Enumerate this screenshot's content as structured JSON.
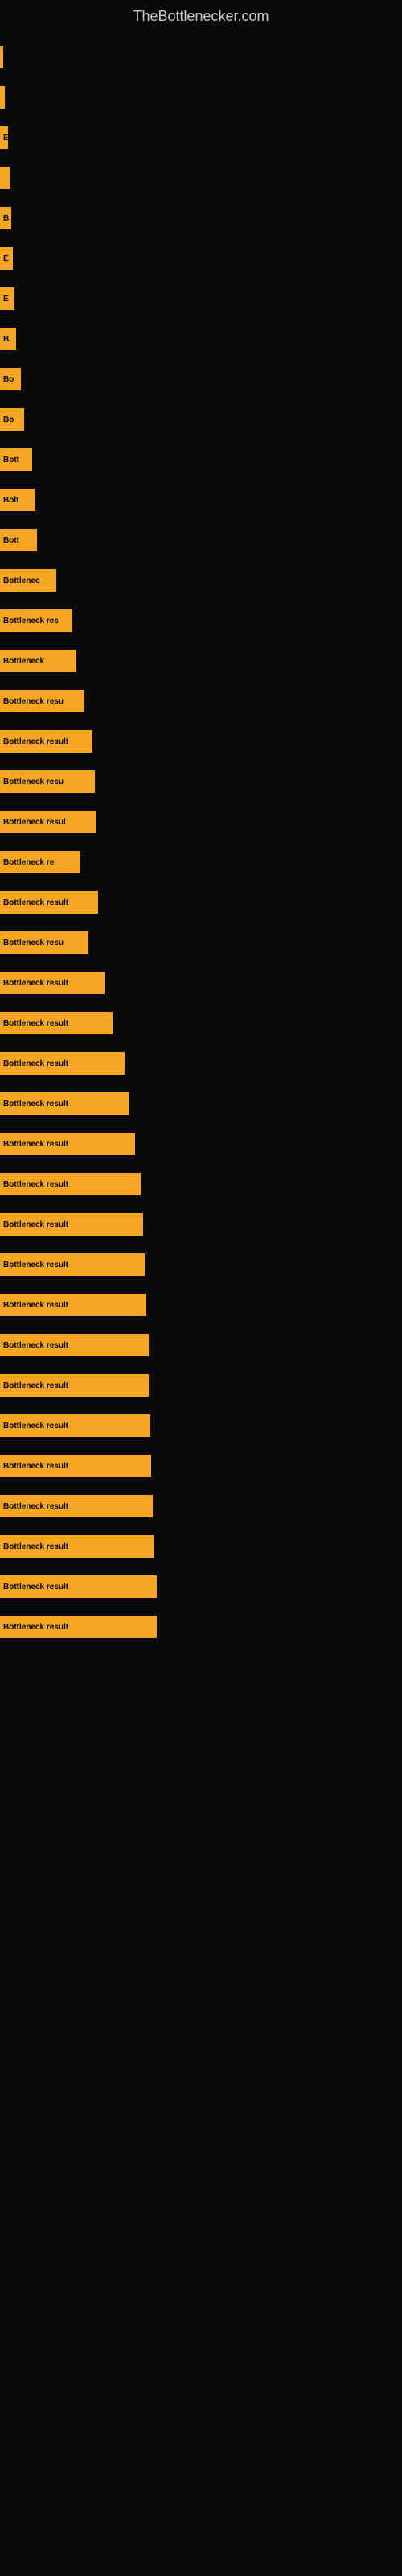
{
  "site": {
    "title": "TheBottlenecker.com"
  },
  "bars": [
    {
      "id": 1,
      "width": 4,
      "label": ""
    },
    {
      "id": 2,
      "width": 6,
      "label": ""
    },
    {
      "id": 3,
      "width": 10,
      "label": "E"
    },
    {
      "id": 4,
      "width": 12,
      "label": ""
    },
    {
      "id": 5,
      "width": 14,
      "label": "B"
    },
    {
      "id": 6,
      "width": 16,
      "label": "E"
    },
    {
      "id": 7,
      "width": 18,
      "label": "E"
    },
    {
      "id": 8,
      "width": 20,
      "label": "B"
    },
    {
      "id": 9,
      "width": 26,
      "label": "Bo"
    },
    {
      "id": 10,
      "width": 30,
      "label": "Bo"
    },
    {
      "id": 11,
      "width": 40,
      "label": "Bott"
    },
    {
      "id": 12,
      "width": 44,
      "label": "Bolt"
    },
    {
      "id": 13,
      "width": 46,
      "label": "Bott"
    },
    {
      "id": 14,
      "width": 70,
      "label": "Bottlenec"
    },
    {
      "id": 15,
      "width": 90,
      "label": "Bottleneck res"
    },
    {
      "id": 16,
      "width": 95,
      "label": "Bottleneck"
    },
    {
      "id": 17,
      "width": 105,
      "label": "Bottleneck resu"
    },
    {
      "id": 18,
      "width": 115,
      "label": "Bottleneck result"
    },
    {
      "id": 19,
      "width": 118,
      "label": "Bottleneck resu"
    },
    {
      "id": 20,
      "width": 120,
      "label": "Bottleneck resul"
    },
    {
      "id": 21,
      "width": 100,
      "label": "Bottleneck re"
    },
    {
      "id": 22,
      "width": 122,
      "label": "Bottleneck result"
    },
    {
      "id": 23,
      "width": 110,
      "label": "Bottleneck resu"
    },
    {
      "id": 24,
      "width": 130,
      "label": "Bottleneck result"
    },
    {
      "id": 25,
      "width": 140,
      "label": "Bottleneck result"
    },
    {
      "id": 26,
      "width": 155,
      "label": "Bottleneck result"
    },
    {
      "id": 27,
      "width": 160,
      "label": "Bottleneck result"
    },
    {
      "id": 28,
      "width": 168,
      "label": "Bottleneck result"
    },
    {
      "id": 29,
      "width": 175,
      "label": "Bottleneck result"
    },
    {
      "id": 30,
      "width": 178,
      "label": "Bottleneck result"
    },
    {
      "id": 31,
      "width": 180,
      "label": "Bottleneck result"
    },
    {
      "id": 32,
      "width": 182,
      "label": "Bottleneck result"
    },
    {
      "id": 33,
      "width": 185,
      "label": "Bottleneck result"
    },
    {
      "id": 34,
      "width": 185,
      "label": "Bottleneck result"
    },
    {
      "id": 35,
      "width": 187,
      "label": "Bottleneck result"
    },
    {
      "id": 36,
      "width": 188,
      "label": "Bottleneck result"
    },
    {
      "id": 37,
      "width": 190,
      "label": "Bottleneck result"
    },
    {
      "id": 38,
      "width": 192,
      "label": "Bottleneck result"
    },
    {
      "id": 39,
      "width": 195,
      "label": "Bottleneck result"
    },
    {
      "id": 40,
      "width": 195,
      "label": "Bottleneck result"
    }
  ]
}
